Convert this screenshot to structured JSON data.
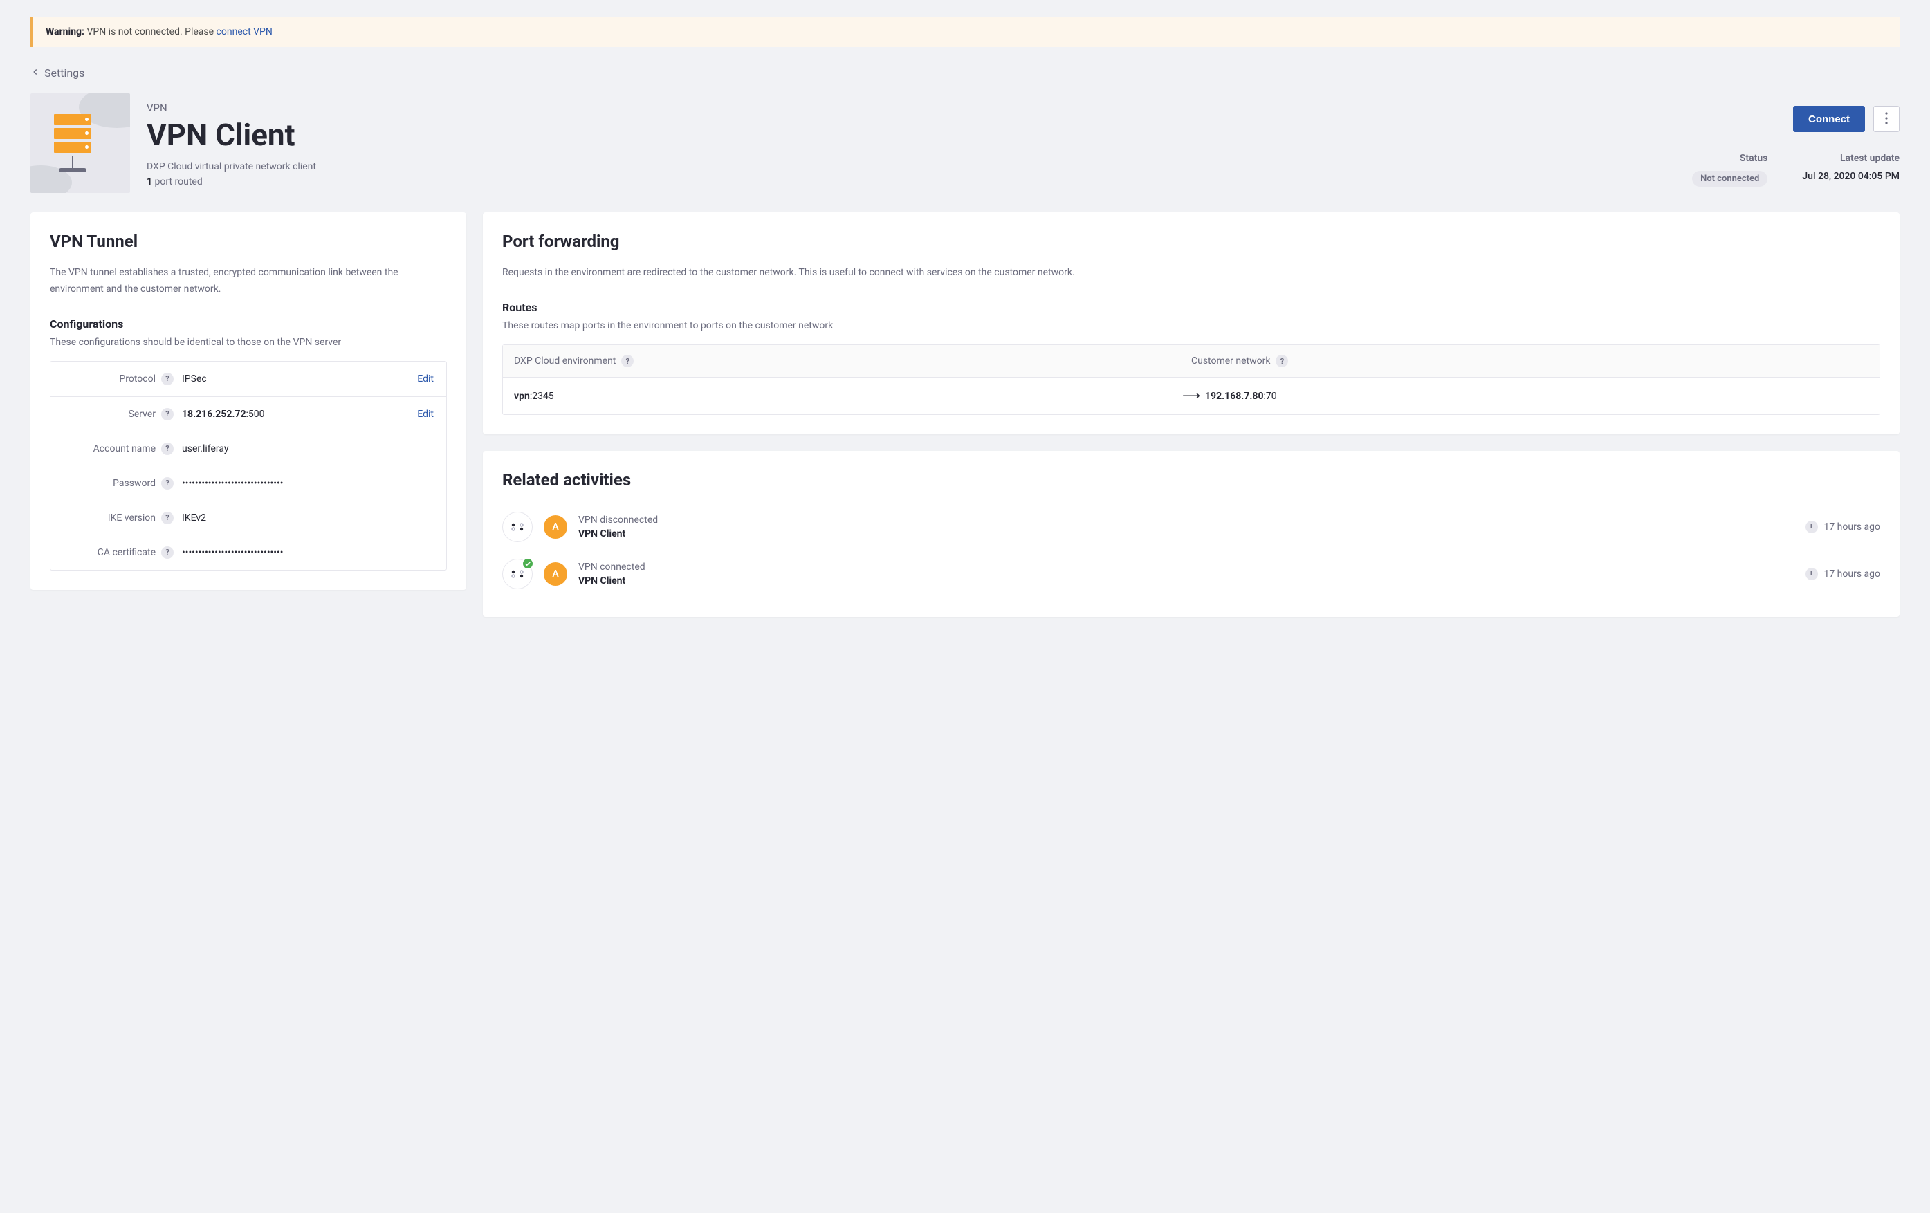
{
  "alert": {
    "prefix": "Warning:",
    "text": " VPN is not connected. Please ",
    "link": "connect VPN"
  },
  "breadcrumb": {
    "label": "Settings"
  },
  "header": {
    "eyebrow": "VPN",
    "title": "VPN Client",
    "subtitle": "DXP Cloud virtual private network client",
    "port_count": "1",
    "port_text": " port routed",
    "connect_label": "Connect"
  },
  "status": {
    "status_label": "Status",
    "status_value": "Not connected",
    "update_label": "Latest update",
    "update_value": "Jul 28, 2020 04:05 PM"
  },
  "tunnel": {
    "heading": "VPN Tunnel",
    "desc": "The VPN tunnel establishes a trusted, encrypted communication link between the environment and the customer network.",
    "config_heading": "Configurations",
    "config_desc": "These configurations should be identical to those on the VPN server",
    "protocol_label": "Protocol",
    "protocol_value": "IPSec",
    "server_label": "Server",
    "server_ip": "18.216.252.72",
    "server_port": ":500",
    "account_label": "Account name",
    "account_value": "user.liferay",
    "password_label": "Password",
    "password_value": "•••••••••••••••••••••••••••••••",
    "ike_label": "IKE version",
    "ike_value": "IKEv2",
    "ca_label": "CA certificate",
    "ca_value": "•••••••••••••••••••••••••••••••",
    "edit": "Edit"
  },
  "forwarding": {
    "heading": "Port forwarding",
    "desc": "Requests in the environment are redirected to the customer network. This is useful to connect with services on the customer network.",
    "routes_heading": "Routes",
    "routes_desc": "These routes map ports in the environment to ports on the customer network",
    "col_env": "DXP Cloud environment",
    "col_cust": "Customer network",
    "route_env_name": "vpn",
    "route_env_port": ":2345",
    "route_cust_ip": "192.168.7.80",
    "route_cust_port": ":70"
  },
  "activities": {
    "heading": "Related activities",
    "items": [
      {
        "title": "VPN disconnected",
        "sub": "VPN Client",
        "time": "17 hours ago",
        "badge": false
      },
      {
        "title": "VPN connected",
        "sub": "VPN Client",
        "time": "17 hours ago",
        "badge": true
      }
    ],
    "avatar_letter": "A"
  }
}
